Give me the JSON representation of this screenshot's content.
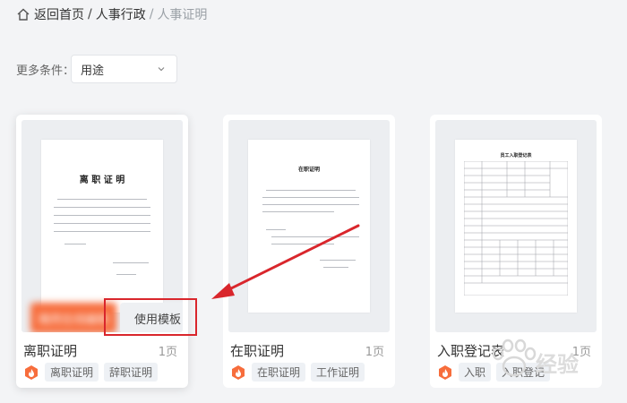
{
  "breadcrumb": {
    "home": "返回首页",
    "level1": "人事行政",
    "current": "人事证明",
    "sep": "/"
  },
  "filter": {
    "label": "更多条件：",
    "select_value": "用途"
  },
  "cards": [
    {
      "name": "离职证明",
      "pages": "1页",
      "tags": [
        "离职证明",
        "辞职证明"
      ],
      "primary_button": "稿壳在线编辑",
      "template_button": "使用模板",
      "doc_title": "离 职 证 明"
    },
    {
      "name": "在职证明",
      "pages": "1页",
      "tags": [
        "在职证明",
        "工作证明"
      ],
      "doc_title": "在职证明"
    },
    {
      "name": "入职登记表",
      "pages": "1页",
      "tags": [
        "入职",
        "入职登记"
      ],
      "doc_title": "员工入职登记表"
    }
  ],
  "watermark": "经验",
  "colors": {
    "accent": "#f76d3c",
    "annotation": "#d9262c",
    "page_bg": "#f3f4f6"
  }
}
